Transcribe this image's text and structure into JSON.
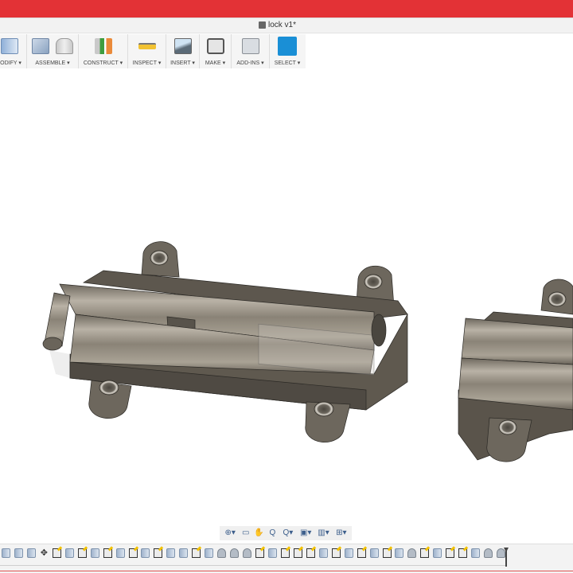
{
  "window": {
    "title": "lock v1*"
  },
  "toolbar": {
    "groups": [
      {
        "label": "ODIFY ▾",
        "icons": [
          "modify-press-pull-icon"
        ]
      },
      {
        "label": "ASSEMBLE ▾",
        "icons": [
          "new-component-icon",
          "joint-icon"
        ]
      },
      {
        "label": "CONSTRUCT ▾",
        "icons": [
          "offset-plane-icon"
        ]
      },
      {
        "label": "INSPECT ▾",
        "icons": [
          "measure-icon"
        ]
      },
      {
        "label": "INSERT ▾",
        "icons": [
          "insert-image-icon"
        ]
      },
      {
        "label": "MAKE ▾",
        "icons": [
          "3d-print-icon"
        ]
      },
      {
        "label": "ADD-INS ▾",
        "icons": [
          "scripts-addins-icon"
        ]
      },
      {
        "label": "SELECT ▾",
        "icons": [
          "select-icon"
        ]
      }
    ]
  },
  "navbar": {
    "items": [
      {
        "icon": "orbit-icon",
        "glyph": "⊕▾"
      },
      {
        "icon": "look-at-icon",
        "glyph": "▭"
      },
      {
        "icon": "pan-icon",
        "glyph": "✋"
      },
      {
        "icon": "zoom-icon",
        "glyph": "Q"
      },
      {
        "icon": "zoom-window-icon",
        "glyph": "Q▾"
      },
      {
        "icon": "display-settings-icon",
        "glyph": "▣▾"
      },
      {
        "icon": "grid-settings-icon",
        "glyph": "▥▾"
      },
      {
        "icon": "viewports-icon",
        "glyph": "⊞▾"
      }
    ]
  },
  "timeline": {
    "features": [
      "extrude",
      "extrude",
      "extrude",
      "move",
      "sketch",
      "extrude",
      "sketch",
      "extrude",
      "sketch",
      "extrude",
      "sketch",
      "extrude",
      "sketch",
      "extrude",
      "extrude",
      "sketch",
      "extrude",
      "fillet",
      "fillet",
      "fillet",
      "sketch",
      "extrude",
      "sketch",
      "sketch",
      "sketch",
      "extrude",
      "sketch",
      "extrude",
      "sketch",
      "extrude",
      "sketch",
      "extrude",
      "fillet",
      "sketch",
      "extrude",
      "sketch",
      "sketch",
      "extrude",
      "fillet",
      "fillet"
    ]
  },
  "colors": {
    "titlebar": "#e33236",
    "select_active": "#1a8fd6",
    "body": "#7a7367"
  }
}
